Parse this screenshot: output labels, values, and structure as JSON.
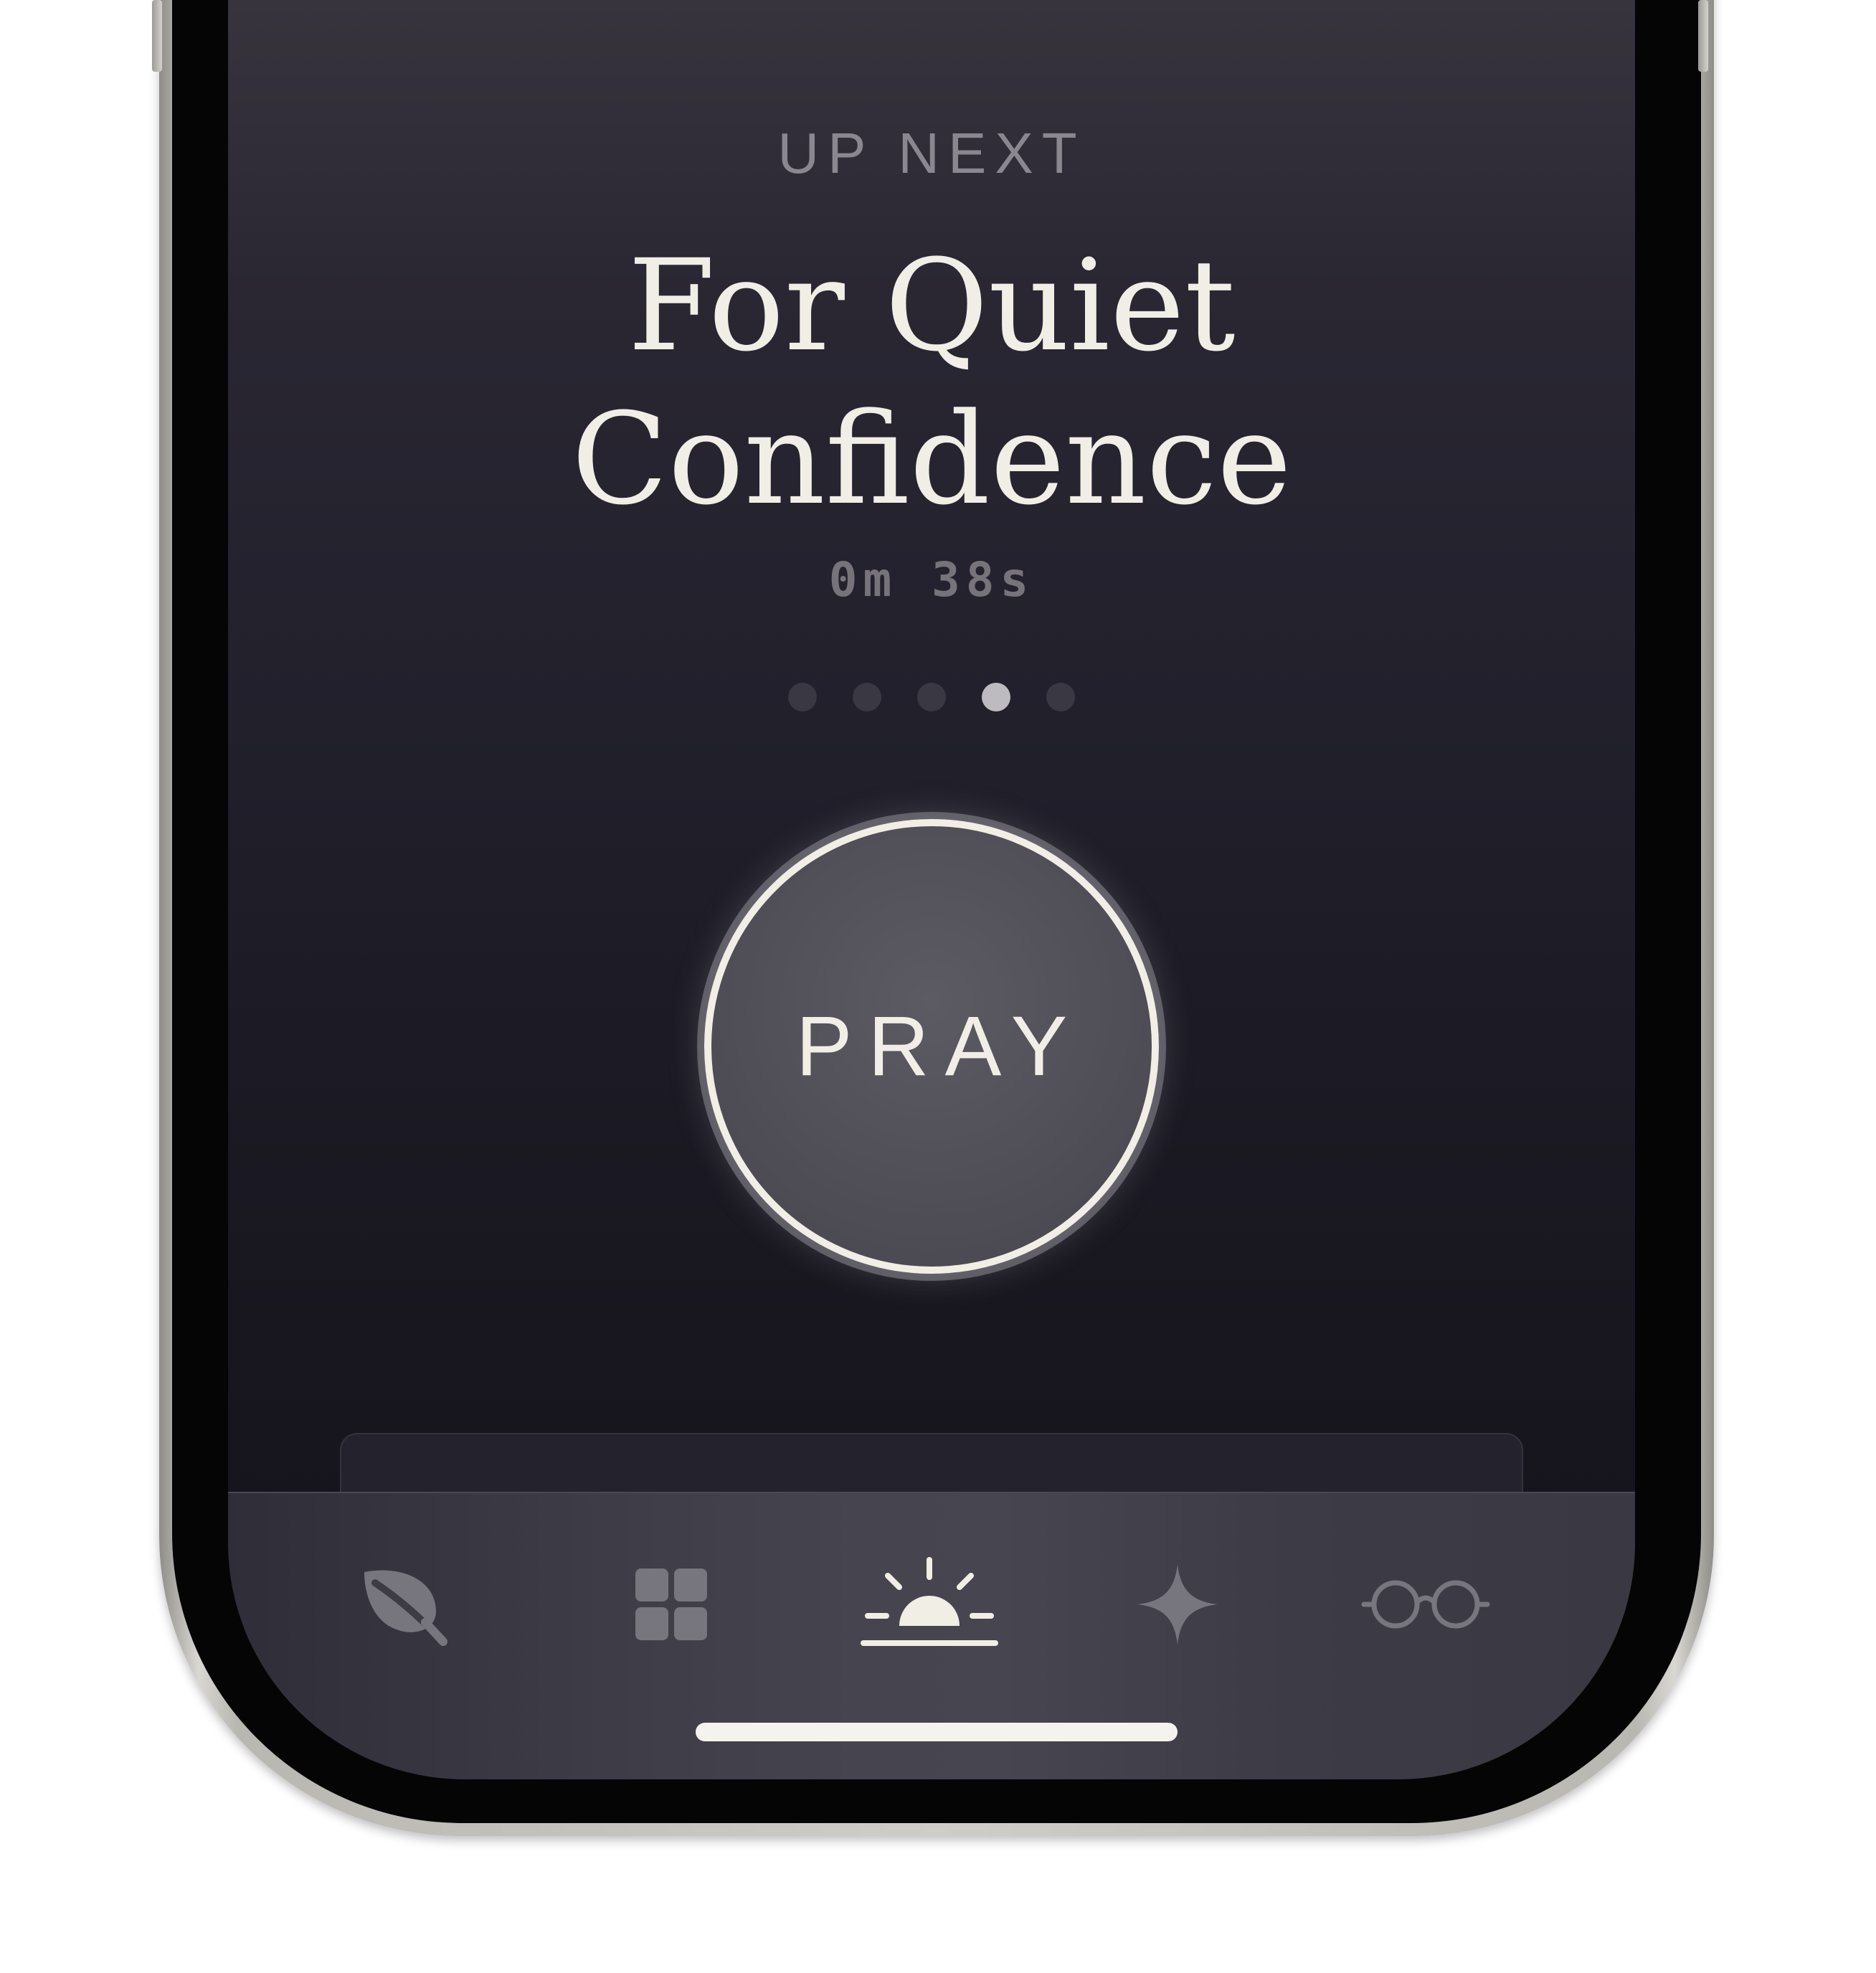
{
  "up_next": {
    "label": "UP NEXT",
    "title": "For Quiet Confidence",
    "duration": "0m 38s"
  },
  "pagination": {
    "count": 5,
    "active_index": 3
  },
  "pray_button": {
    "label": "PRAY"
  },
  "tab_bar": {
    "tabs": [
      {
        "icon": "leaf-icon",
        "selected": false
      },
      {
        "icon": "grid-icon",
        "selected": false
      },
      {
        "icon": "sunrise-icon",
        "selected": true
      },
      {
        "icon": "sparkle-icon",
        "selected": false
      },
      {
        "icon": "glasses-icon",
        "selected": false
      }
    ]
  },
  "colors": {
    "text_primary": "#f1eee6",
    "text_muted": "#8a8790",
    "icon_inactive": "#77757d",
    "icon_active": "#f1eee6",
    "background_top": "#3a3640",
    "background_bottom": "#14121b"
  }
}
